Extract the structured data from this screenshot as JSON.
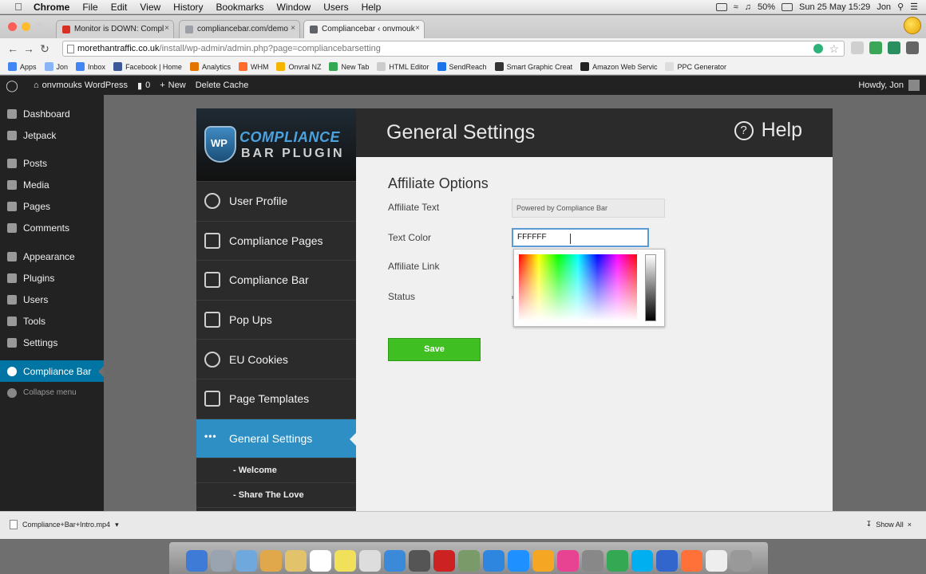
{
  "menubar": {
    "app_name": "Chrome",
    "items": [
      "File",
      "Edit",
      "View",
      "History",
      "Bookmarks",
      "Window",
      "Users",
      "Help"
    ],
    "battery": "50%",
    "datetime": "Sun 25 May  15:29",
    "user": "Jon"
  },
  "tabs": [
    {
      "label": "Monitor is DOWN: Compl",
      "color": "#d93025"
    },
    {
      "label": "compliancebar.com/demo",
      "color": "#9aa0a6"
    },
    {
      "label": "Compliancebar ‹ onvmouk",
      "color": "#5f6368"
    }
  ],
  "address": {
    "host": "morethantraffic.co.uk",
    "path": "/install/wp-admin/admin.php?page=compliancebarsetting"
  },
  "bookmarks": [
    {
      "label": "Apps",
      "color": "#4285f4"
    },
    {
      "label": "Jon",
      "color": "#8ab4f8"
    },
    {
      "label": "Inbox",
      "color": "#4285f4"
    },
    {
      "label": "Facebook | Home",
      "color": "#3b5998"
    },
    {
      "label": "Analytics",
      "color": "#e37400"
    },
    {
      "label": "WHM",
      "color": "#ff6c2c"
    },
    {
      "label": "Onvral NZ",
      "color": "#f4b400"
    },
    {
      "label": "New Tab",
      "color": "#34a853"
    },
    {
      "label": "HTML Editor",
      "color": "#cccccc"
    },
    {
      "label": "SendReach",
      "color": "#1a73e8"
    },
    {
      "label": "Smart Graphic Creat",
      "color": "#333333"
    },
    {
      "label": "Amazon Web Servic",
      "color": "#222222"
    },
    {
      "label": "PPC Generator",
      "color": "#dddddd"
    }
  ],
  "adminbar": {
    "site": "onvmouks WordPress",
    "comments": "0",
    "new_label": "New",
    "cache": "Delete Cache",
    "howdy": "Howdy, Jon"
  },
  "wpmenu": [
    {
      "label": "Dashboard"
    },
    {
      "label": "Jetpack"
    },
    {
      "label": "Posts"
    },
    {
      "label": "Media"
    },
    {
      "label": "Pages"
    },
    {
      "label": "Comments"
    },
    {
      "label": "Appearance"
    },
    {
      "label": "Plugins"
    },
    {
      "label": "Users"
    },
    {
      "label": "Tools"
    },
    {
      "label": "Settings"
    },
    {
      "label": "Compliance Bar"
    },
    {
      "label": "Collapse menu"
    }
  ],
  "plugin": {
    "logo_line1": "COMPLIANCE",
    "logo_line2": "BAR PLUGIN",
    "logo_badge": "WP",
    "nav": [
      {
        "label": "User Profile"
      },
      {
        "label": "Compliance Pages"
      },
      {
        "label": "Compliance Bar"
      },
      {
        "label": "Pop Ups"
      },
      {
        "label": "EU Cookies"
      },
      {
        "label": "Page Templates"
      },
      {
        "label": "General Settings"
      }
    ],
    "active_icon": "•••",
    "subnav": [
      "- Welcome",
      "- Share The Love"
    ],
    "page_title": "General Settings",
    "help_label": "Help",
    "help_glyph": "?"
  },
  "form": {
    "section_title": "Affiliate Options",
    "affiliate_text_label": "Affiliate Text",
    "affiliate_text_value": "Powered by Compliance Bar",
    "text_color_label": "Text Color",
    "text_color_value": "FFFFFF",
    "affiliate_link_label": "Affiliate Link",
    "status_label": "Status",
    "save_label": "Save"
  },
  "downloads": {
    "file": "Compliance+Bar+Intro.mp4",
    "show_all": "Show All"
  },
  "dock_apps": [
    "#3d7bd6",
    "#9aa4b0",
    "#6fa8dc",
    "#e0a84a",
    "#e2c36b",
    "#ffffff",
    "#f1e05a",
    "#dddddd",
    "#3b8ad9",
    "#555555",
    "#cc2222",
    "#7a9a6a",
    "#2e86de",
    "#1e90ff",
    "#f5a623",
    "#e84393",
    "#888888",
    "#34a853",
    "#00aff0",
    "#3366cc",
    "#ff7139",
    "#eeeeee",
    "#999999"
  ]
}
